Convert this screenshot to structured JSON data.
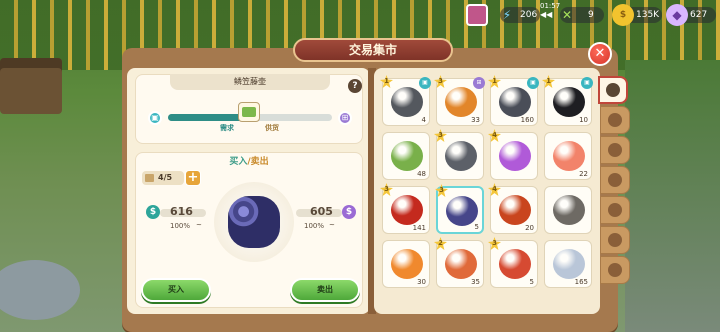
{
  "window": {
    "title": "交易集市"
  },
  "hud": {
    "energy": "206",
    "timer": "01:57",
    "items": "9",
    "coins": "135K",
    "gems": "627"
  },
  "item_panel": {
    "name": "鳞笠藤壶",
    "demand_label": "需求",
    "supply_label": "供货",
    "supply_level": 0.55
  },
  "trade": {
    "title_buy": "买入",
    "title_slash": "/",
    "title_sell": "卖出",
    "count": "4/5",
    "buy_price": "616",
    "buy_pct": "100%",
    "sell_price": "605",
    "sell_pct": "100%",
    "buy_button": "买入",
    "sell_button": "卖出"
  },
  "grid": [
    {
      "name": "dark-ore",
      "qty": "4",
      "lvl": "1",
      "tag": "cube",
      "color": "#54585e"
    },
    {
      "name": "monarch-butterfly",
      "qty": "33",
      "lvl": "3",
      "tag": "cart",
      "color": "#e2862a"
    },
    {
      "name": "mussel-rocks",
      "qty": "160",
      "lvl": "1",
      "tag": "cube",
      "color": "#4a4e58"
    },
    {
      "name": "black-caviar",
      "qty": "10",
      "lvl": "1",
      "tag": "cube",
      "color": "#1e1e22"
    },
    {
      "name": "green-bundle",
      "qty": "48",
      "lvl": "",
      "tag": "",
      "color": "#79b04a"
    },
    {
      "name": "grey-ore",
      "qty": "",
      "lvl": "3",
      "tag": "",
      "color": "#5c6068"
    },
    {
      "name": "rainbow-bar",
      "qty": "",
      "lvl": "4",
      "tag": "",
      "color": "#b05ad8"
    },
    {
      "name": "salmon-steak",
      "qty": "22",
      "lvl": "",
      "tag": "",
      "color": "#f2836a"
    },
    {
      "name": "red-chili",
      "qty": "141",
      "lvl": "3",
      "tag": "",
      "color": "#c42a1e"
    },
    {
      "name": "barnacle-cluster",
      "qty": "5",
      "lvl": "3",
      "tag": "",
      "color": "#46468a"
    },
    {
      "name": "hermit-crab",
      "qty": "20",
      "lvl": "4",
      "tag": "",
      "color": "#c9451e"
    },
    {
      "name": "iron-ingot",
      "qty": "",
      "lvl": "",
      "tag": "",
      "color": "#6e6a64"
    },
    {
      "name": "octopus",
      "qty": "30",
      "lvl": "",
      "tag": "",
      "color": "#f0892e"
    },
    {
      "name": "seahorse",
      "qty": "35",
      "lvl": "2",
      "tag": "",
      "color": "#e06a3a"
    },
    {
      "name": "red-crab",
      "qty": "5",
      "lvl": "3",
      "tag": "",
      "color": "#d64a32"
    },
    {
      "name": "crystal",
      "qty": "165",
      "lvl": "",
      "tag": "",
      "color": "#b9c6d8"
    }
  ],
  "tabs": [
    "clock",
    "shell",
    "flower",
    "fish",
    "bug",
    "fish-bone",
    "misc"
  ]
}
